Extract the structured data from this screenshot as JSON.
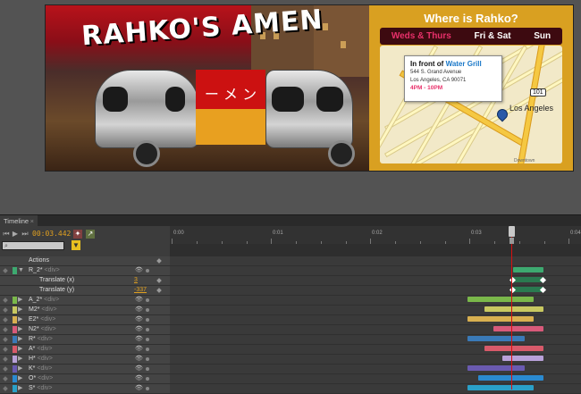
{
  "banner": {
    "title": "RAHKO'S AMEN",
    "noodle_text": "ー メ ン",
    "map": {
      "heading": "Where is Rahko?",
      "days": [
        "Weds & Thurs",
        "Fri & Sat",
        "Sun"
      ],
      "callout_prefix": "In front of",
      "callout_venue": "Water Grill",
      "address_line1": "544 S. Grand Avenue",
      "address_line2": "Los Angeles, CA 90071",
      "hours": "4PM - 10PM",
      "city_label": "Los Angeles",
      "highway": "101",
      "downtown": "Downtown",
      "colors": {
        "accent_pink": "#e8306a",
        "venue_blue": "#1a78c8",
        "panel": "#d9a021"
      }
    }
  },
  "timeline": {
    "tab_label": "Timeline",
    "time": "00:03.442",
    "search_placeholder": "",
    "ruler_labels": [
      "0:00",
      "0:01",
      "0:02",
      "0:03",
      "0:04"
    ],
    "rows": [
      {
        "name": "Actions",
        "type": "header"
      },
      {
        "name": "R_2*",
        "tag": "<div>",
        "expanded": true,
        "color": "#3daa70"
      },
      {
        "name": "Translate (x)",
        "value": "3",
        "type": "prop"
      },
      {
        "name": "Translate (y)",
        "value": "-337",
        "type": "prop"
      },
      {
        "name": "A_2*",
        "tag": "<div>",
        "color": "#7ab84a"
      },
      {
        "name": "M2*",
        "tag": "<div>",
        "color": "#c8c860"
      },
      {
        "name": "E2*",
        "tag": "<div>",
        "color": "#d8b050"
      },
      {
        "name": "N2*",
        "tag": "<div>",
        "color": "#d85a7a"
      },
      {
        "name": "R*",
        "tag": "<div>",
        "color": "#3a7ab8"
      },
      {
        "name": "A*",
        "tag": "<div>",
        "color": "#d85a6a"
      },
      {
        "name": "H*",
        "tag": "<div>",
        "color": "#b8a0d8"
      },
      {
        "name": "K*",
        "tag": "<div>",
        "color": "#6a5ab0"
      },
      {
        "name": "O*",
        "tag": "<div>",
        "color": "#2a8ad0"
      },
      {
        "name": "S*",
        "tag": "<div>",
        "color": "#2aa0c8"
      }
    ]
  }
}
